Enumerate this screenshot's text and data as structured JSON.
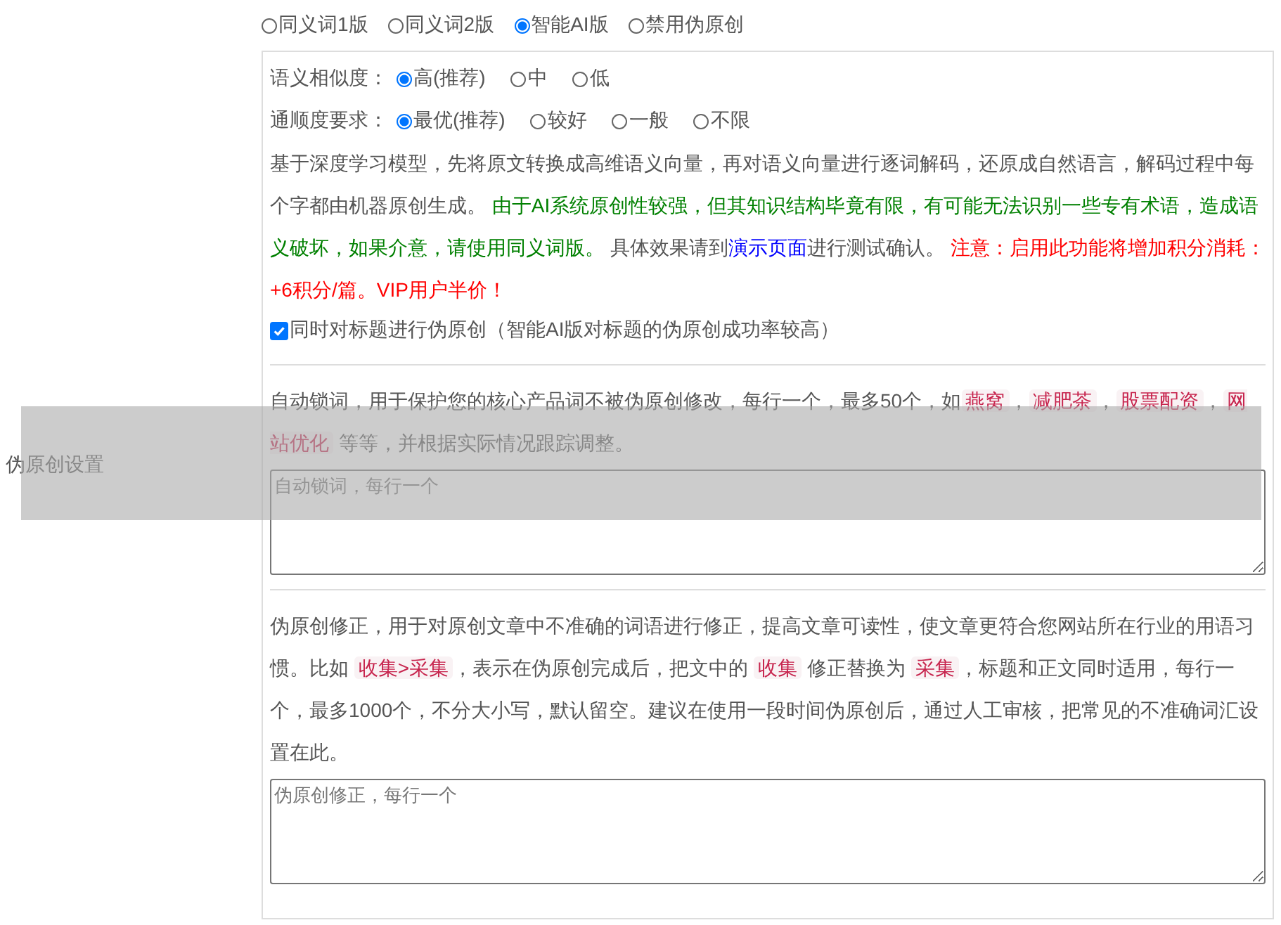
{
  "row_label": "伪原创设置",
  "version_options": [
    {
      "label": "同义词1版",
      "selected": false
    },
    {
      "label": "同义词2版",
      "selected": false
    },
    {
      "label": "智能AI版",
      "selected": true
    },
    {
      "label": "禁用伪原创",
      "selected": false
    }
  ],
  "ai_panel": {
    "settings": [
      {
        "label": "语义相似度：",
        "options": [
          {
            "label": "高(推荐)",
            "selected": true
          },
          {
            "label": "中",
            "selected": false
          },
          {
            "label": "低",
            "selected": false
          }
        ]
      },
      {
        "label": "通顺度要求：",
        "options": [
          {
            "label": "最优(推荐)",
            "selected": true
          },
          {
            "label": "较好",
            "selected": false
          },
          {
            "label": "一般",
            "selected": false
          },
          {
            "label": "不限",
            "selected": false
          }
        ]
      }
    ],
    "description": [
      {
        "kind": "plain",
        "text": "基于深度学习模型，先将原文转换成高维语义向量，再对语义向量进行逐词解码，还原成自然语言，解码过程中每个字都由机器原创生成。 "
      },
      {
        "kind": "green",
        "text": "由于AI系统原创性较强，但其知识结构毕竟有限，有可能无法识别一些专有术语，造成语义破坏，如果介意，请使用同义词版。"
      },
      {
        "kind": "plain",
        "text": " 具体效果请到"
      },
      {
        "kind": "link",
        "text": "演示页面"
      },
      {
        "kind": "plain",
        "text": "进行测试确认。 "
      },
      {
        "kind": "red",
        "text": "注意：启用此功能将增加积分消耗：+6积分/篇。VIP用户半价！"
      }
    ],
    "title_checkbox": {
      "label": "同时对标题进行伪原创（智能AI版对标题的伪原创成功率较高）",
      "checked": true
    }
  },
  "lock_words": {
    "description": [
      {
        "kind": "plain",
        "text": "自动锁词，用于保护您的核心产品词不被伪原创修改，每行一个，最多50个，如"
      },
      {
        "kind": "code",
        "text": "燕窝"
      },
      {
        "kind": "plain",
        "text": "，"
      },
      {
        "kind": "code",
        "text": "减肥茶"
      },
      {
        "kind": "plain",
        "text": "，"
      },
      {
        "kind": "code",
        "text": "股票配资"
      },
      {
        "kind": "plain",
        "text": "，"
      },
      {
        "kind": "code",
        "text": "网站优化"
      },
      {
        "kind": "plain",
        "text": " 等等，并根据实际情况跟踪调整。"
      }
    ],
    "placeholder": "自动锁词，每行一个"
  },
  "correction": {
    "description": [
      {
        "kind": "plain",
        "text": "伪原创修正，用于对原创文章中不准确的词语进行修正，提高文章可读性，使文章更符合您网站所在行业的用语习惯。比如 "
      },
      {
        "kind": "code",
        "text": "收集>采集"
      },
      {
        "kind": "plain",
        "text": "，表示在伪原创完成后，把文中的 "
      },
      {
        "kind": "code",
        "text": "收集"
      },
      {
        "kind": "plain",
        "text": " 修正替换为 "
      },
      {
        "kind": "code",
        "text": "采集"
      },
      {
        "kind": "plain",
        "text": "，标题和正文同时适用，每行一个，最多1000个，不分大小写，默认留空。建议在使用一段时间伪原创后，通过人工审核，把常见的不准确词汇设置在此。"
      }
    ],
    "placeholder": "伪原创修正，每行一个"
  }
}
